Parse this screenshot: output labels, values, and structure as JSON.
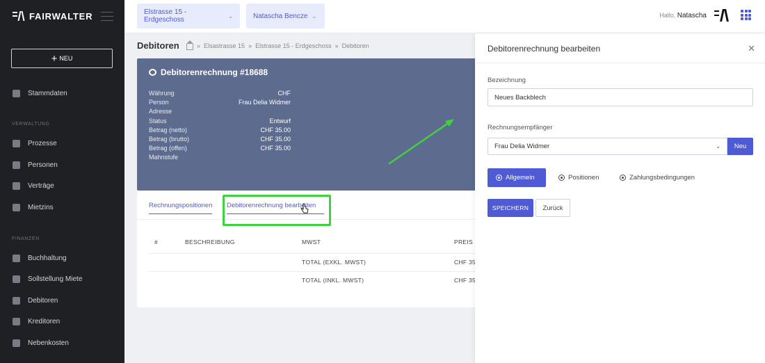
{
  "brand": {
    "logo_text": "FAIRWALTER"
  },
  "sidebar": {
    "new_label": "NEU",
    "items_top": [
      {
        "label": "Stammdaten",
        "icon": "database-icon"
      }
    ],
    "sections": [
      {
        "title": "VERWALTUNG",
        "items": [
          {
            "label": "Prozesse",
            "icon": "list-icon"
          },
          {
            "label": "Personen",
            "icon": "people-icon"
          },
          {
            "label": "Verträge",
            "icon": "contract-icon"
          },
          {
            "label": "Mietzins",
            "icon": "coins-icon"
          }
        ]
      },
      {
        "title": "FINANZEN",
        "items": [
          {
            "label": "Buchhaltung",
            "icon": "ledger-icon"
          },
          {
            "label": "Sollstellung Miete",
            "icon": "coins-icon"
          },
          {
            "label": "Debitoren",
            "icon": "coins-icon"
          },
          {
            "label": "Kreditoren",
            "icon": "coins-icon"
          },
          {
            "label": "Nebenkosten",
            "icon": "flame-icon"
          }
        ]
      }
    ]
  },
  "topbar": {
    "property_select": "Elstrasse 15 - Erdgeschoss",
    "user_select": "Natascha Bencze",
    "hello_prefix": "Hallo,",
    "hello_name": "Natascha"
  },
  "page": {
    "title": "Debitoren",
    "breadcrumb": [
      "Elsastrasse 15",
      "Elstrasse 15 - Erdgeschoss",
      "Debitoren"
    ]
  },
  "invoice": {
    "title": "Debitorenrechnung #18688",
    "fields": [
      {
        "key": "Währung",
        "value": "CHF"
      },
      {
        "key": "Person",
        "value": "Frau Delia Widmer"
      },
      {
        "key": "Adresse",
        "value": ""
      },
      {
        "key": "Status",
        "value": "Entwurf"
      },
      {
        "key": "Betrag (netto)",
        "value": "CHF 35.00"
      },
      {
        "key": "Betrag (brutto)",
        "value": "CHF 35.00"
      },
      {
        "key": "Betrag (offen)",
        "value": "CHF 35.00"
      },
      {
        "key": "Mahnstufe",
        "value": ""
      }
    ]
  },
  "tabs": {
    "tab1": "Rechnungspositionen",
    "tab2": "Debitorenrechnung bearbeiten"
  },
  "table": {
    "headers": [
      "#",
      "BESCHREIBUNG",
      "MWST",
      "PREIS ("
    ],
    "rows": [
      {
        "label": "TOTAL (EXKL. MWST)",
        "price": "CHF 35"
      },
      {
        "label": "TOTAL (INKL. MWST)",
        "price": "CHF 35"
      }
    ]
  },
  "drawer": {
    "title": "Debitorenrechnung bearbeiten",
    "bezeichnung_label": "Bezeichnung",
    "bezeichnung_value": "Neues Backblech",
    "empfaenger_label": "Rechnungsempfänger",
    "empfaenger_value": "Frau Delia Widmer",
    "neu_button": "Neu",
    "segments": [
      "Allgemein",
      "Positionen",
      "Zahlungsbedingungen"
    ],
    "save_button": "SPEICHERN",
    "back_button": "Zurück"
  },
  "colors": {
    "accent": "#4f5bd5",
    "sidebar_bg": "#1f2024",
    "card_bg": "#5d6b8e",
    "highlight": "#3ed33e"
  }
}
